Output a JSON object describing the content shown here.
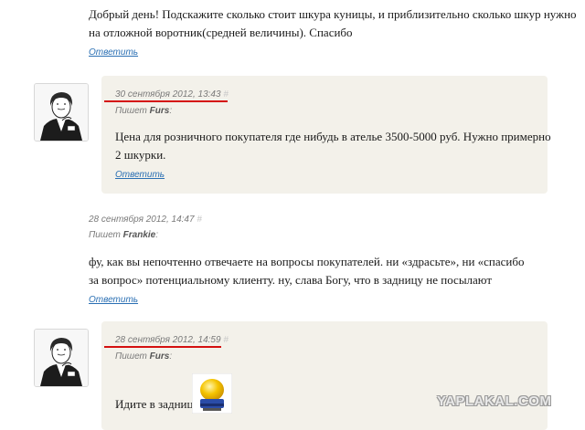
{
  "comment1": {
    "text_line1": "Добрый день! Подскажите сколько стоит шкура куницы, и приблизительно сколько шкур нужно",
    "text_line2": "на отложной воротник(средней величины). Спасибо",
    "reply": "Ответить"
  },
  "reply1": {
    "date": "30 сентября 2012, 13:43",
    "hash": "#",
    "author_prefix": "Пишет",
    "author": "Furs",
    "author_suffix": ":",
    "text_line1": "Цена для розничного покупателя где нибудь в ателье 3500-5000 руб. Нужно примерно",
    "text_line2": "2 шкурки.",
    "reply": "Ответить"
  },
  "comment2": {
    "date": "28 сентября 2012, 14:47",
    "hash": "#",
    "author_prefix": "Пишет",
    "author": "Frankie",
    "author_suffix": ":",
    "text_line1": "фу, как вы непочтенно отвечаете на вопросы покупателей. ни «здрасьте», ни «спасибо",
    "text_line2": "за вопрос» потенциальному клиенту. ну, слава Богу, что в задницу не посылают",
    "reply": "Ответить"
  },
  "reply2": {
    "date": "28 сентября 2012, 14:59",
    "hash": "#",
    "author_prefix": "Пишет",
    "author": "Furs",
    "author_suffix": ":",
    "text": "Идите в задницу."
  },
  "watermark": "YAPLAKAL.COM",
  "colors": {
    "highlight": "#d41010",
    "link": "#2a6fb3",
    "box": "#f3f1ea"
  },
  "icons": [
    "user-avatar",
    "emoticon-smiley"
  ]
}
